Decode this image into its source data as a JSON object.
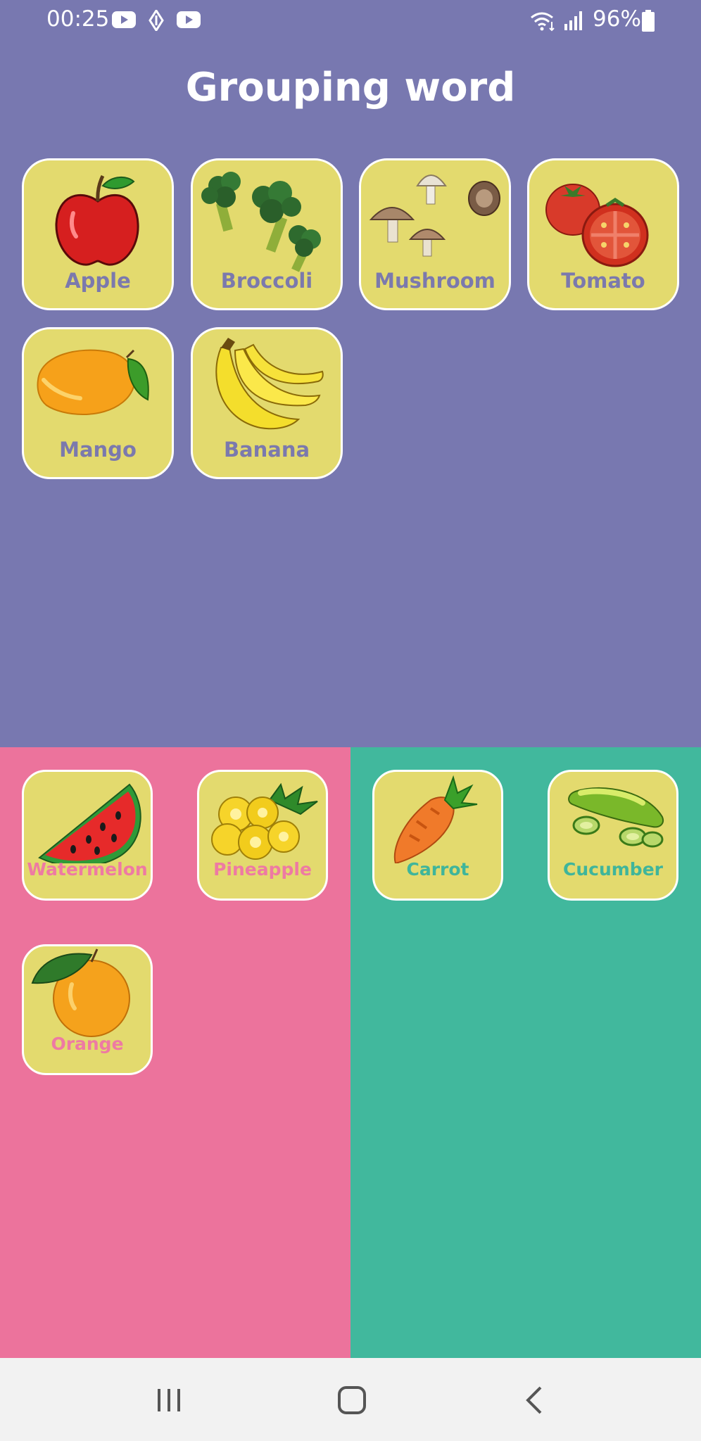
{
  "status_bar": {
    "time": "00:25",
    "battery": "96%",
    "icons": [
      "youtube-icon",
      "navigation-icon",
      "youtube-icon",
      "wifi-icon",
      "signal-icon",
      "battery-icon"
    ]
  },
  "title": "Grouping word",
  "colors": {
    "top_panel": "#7878b0",
    "fruit_panel": "#ec739c",
    "vegetable_panel": "#41b89d",
    "card": "#e3da6e"
  },
  "unsorted": [
    {
      "label": "Apple",
      "icon": "apple-icon"
    },
    {
      "label": "Broccoli",
      "icon": "broccoli-icon"
    },
    {
      "label": "Mushroom",
      "icon": "mushroom-icon"
    },
    {
      "label": "Tomato",
      "icon": "tomato-icon"
    },
    {
      "label": "Mango",
      "icon": "mango-icon"
    },
    {
      "label": "Banana",
      "icon": "banana-icon"
    }
  ],
  "fruit_group": [
    {
      "label": "Watermelon",
      "icon": "watermelon-icon"
    },
    {
      "label": "Pineapple",
      "icon": "pineapple-icon"
    },
    {
      "label": "Orange",
      "icon": "orange-icon"
    }
  ],
  "vegetable_group": [
    {
      "label": "Carrot",
      "icon": "carrot-icon"
    },
    {
      "label": "Cucumber",
      "icon": "cucumber-icon"
    }
  ],
  "nav": [
    "recent-apps-icon",
    "home-icon",
    "back-icon"
  ]
}
